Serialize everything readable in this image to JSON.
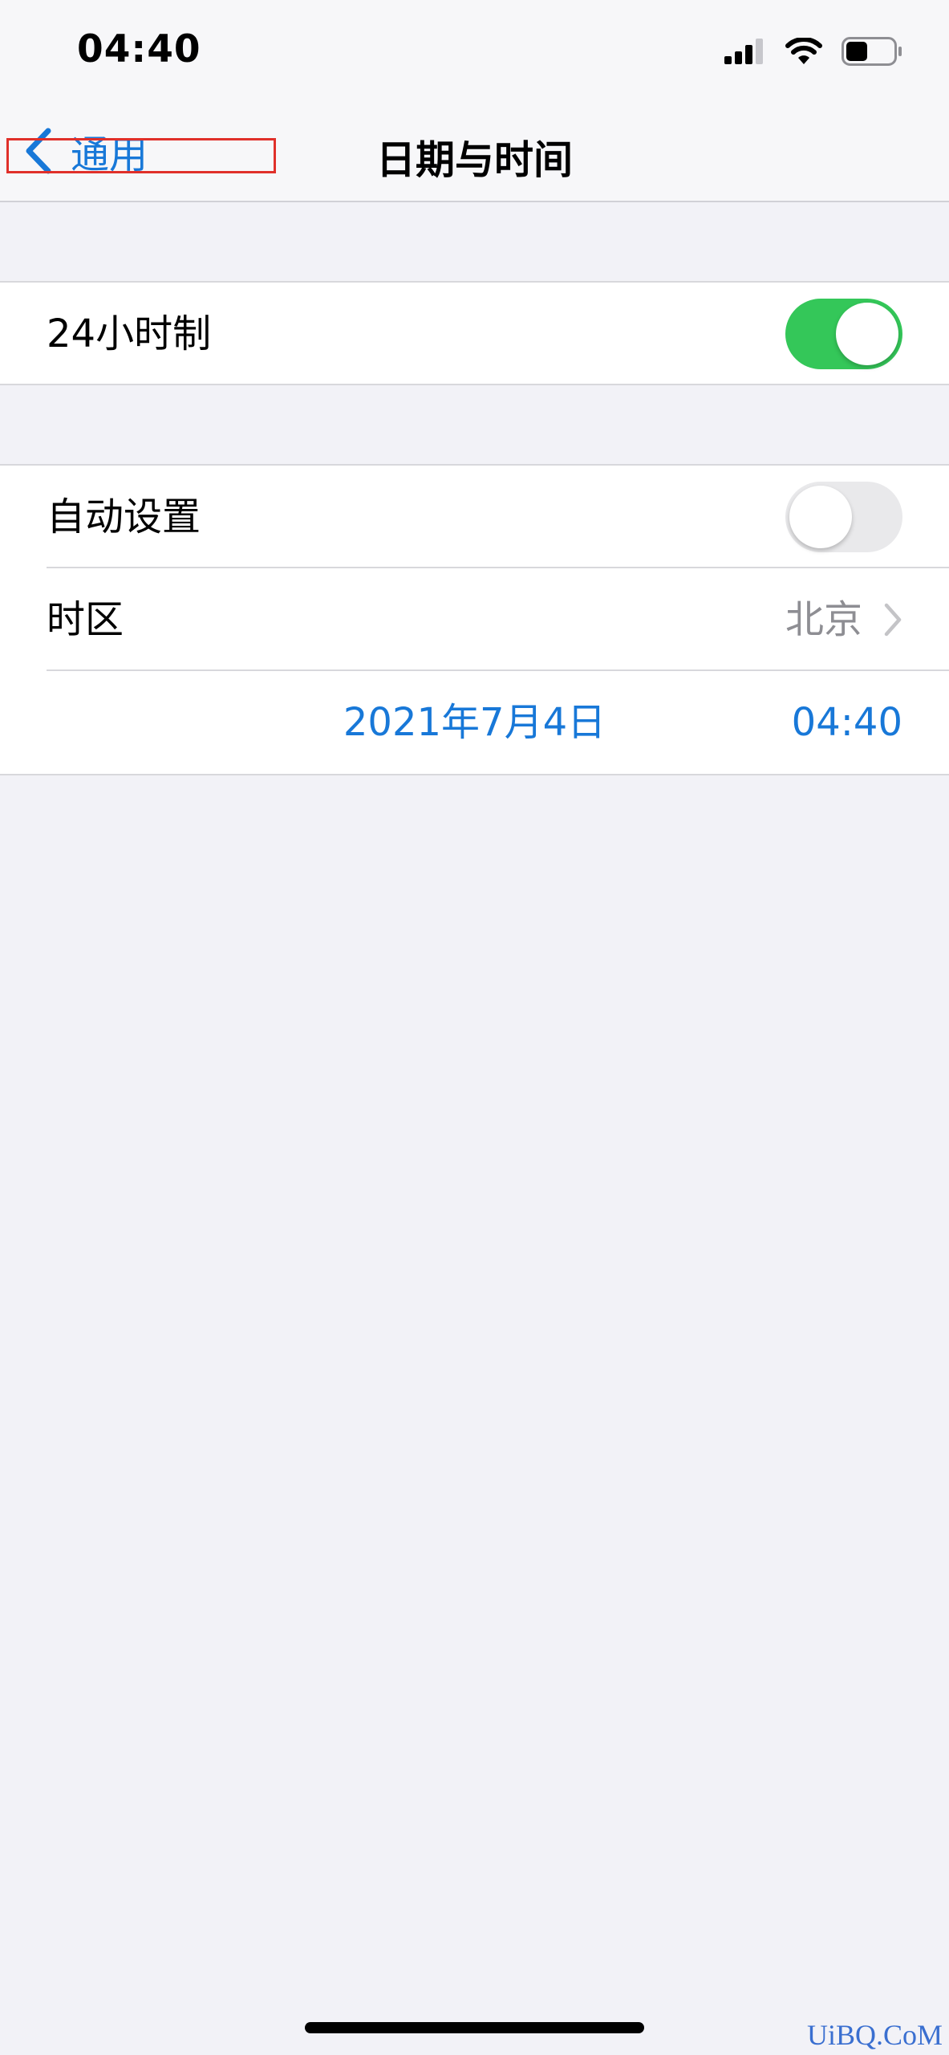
{
  "status_bar": {
    "time": "04:40",
    "icons": [
      "signal-icon",
      "wifi-icon",
      "battery-icon"
    ],
    "battery_level": 0.45
  },
  "nav": {
    "back_label": "通用",
    "title": "日期与时间"
  },
  "settings": {
    "hour24": {
      "label": "24小时制",
      "enabled": true
    },
    "auto_set": {
      "label": "自动设置",
      "enabled": false
    },
    "timezone": {
      "label": "时区",
      "value": "北京"
    },
    "date": "2021年7月4日",
    "time": "04:40"
  },
  "colors": {
    "accent": "#1878d8",
    "toggle_on": "#34c759",
    "toggle_off": "#e9e9eb",
    "background": "#f2f2f7",
    "highlight": "#e0302a"
  },
  "watermark": "UiBQ.CoM"
}
